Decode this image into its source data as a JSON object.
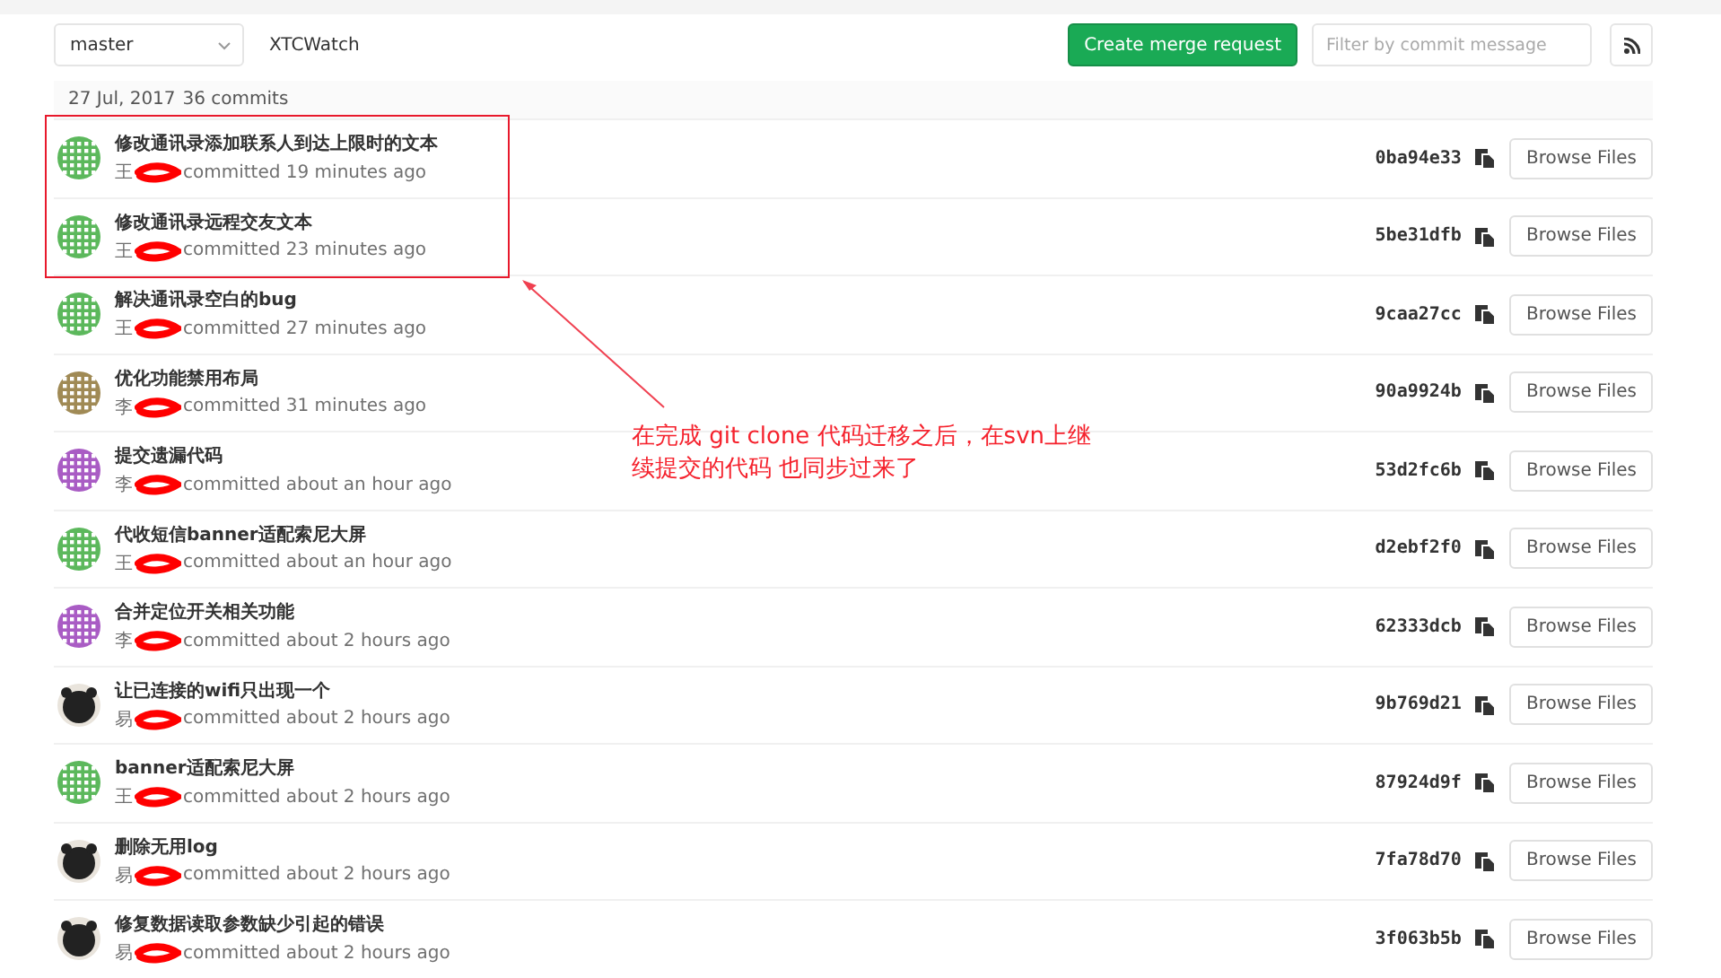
{
  "toolbar": {
    "branch": "master",
    "project": "XTCWatch",
    "merge_button": "Create merge request",
    "filter": {
      "placeholder": "Filter by commit message"
    }
  },
  "day_header": {
    "date": "27 Jul, 2017",
    "count": "36 commits"
  },
  "commits": [
    {
      "title": "修改通讯录添加联系人到达上限时的文本",
      "author": "王",
      "redacted": true,
      "time": "committed 19 minutes ago",
      "sha": "0ba94e33",
      "browse": "Browse Files",
      "avatar": {
        "kind": "identicon",
        "color": "#5cb85c"
      }
    },
    {
      "title": "修改通讯录远程交友文本",
      "author": "王",
      "redacted": true,
      "time": "committed 23 minutes ago",
      "sha": "5be31dfb",
      "browse": "Browse Files",
      "avatar": {
        "kind": "identicon",
        "color": "#5cb85c"
      }
    },
    {
      "title": "解决通讯录空白的bug",
      "author": "王",
      "redacted": true,
      "time": "committed 27 minutes ago",
      "sha": "9caa27cc",
      "browse": "Browse Files",
      "avatar": {
        "kind": "identicon",
        "color": "#5cb85c"
      }
    },
    {
      "title": "优化功能禁用布局",
      "author": "李",
      "redacted": true,
      "time": "committed 31 minutes ago",
      "sha": "90a9924b",
      "browse": "Browse Files",
      "avatar": {
        "kind": "identicon",
        "color": "#a08a55"
      }
    },
    {
      "title": "提交遗漏代码",
      "author": "李",
      "redacted": true,
      "time": "committed about an hour ago",
      "sha": "53d2fc6b",
      "browse": "Browse Files",
      "avatar": {
        "kind": "identicon",
        "color": "#a95cc4"
      }
    },
    {
      "title": "代收短信banner适配索尼大屏",
      "author": "王",
      "redacted": true,
      "time": "committed about an hour ago",
      "sha": "d2ebf2f0",
      "browse": "Browse Files",
      "avatar": {
        "kind": "identicon",
        "color": "#5cb85c"
      }
    },
    {
      "title": "合并定位开关相关功能",
      "author": "李",
      "redacted": true,
      "time": "committed about 2 hours ago",
      "sha": "62333dcb",
      "browse": "Browse Files",
      "avatar": {
        "kind": "identicon",
        "color": "#a95cc4"
      }
    },
    {
      "title": "让已连接的wifi只出现一个",
      "author": "易",
      "redacted": true,
      "time": "committed about 2 hours ago",
      "sha": "9b769d21",
      "browse": "Browse Files",
      "avatar": {
        "kind": "figure",
        "color": "#222222"
      }
    },
    {
      "title": "banner适配索尼大屏",
      "author": "王",
      "redacted": true,
      "time": "committed about 2 hours ago",
      "sha": "87924d9f",
      "browse": "Browse Files",
      "avatar": {
        "kind": "identicon",
        "color": "#5cb85c"
      }
    },
    {
      "title": "删除无用log",
      "author": "易",
      "redacted": true,
      "time": "committed about 2 hours ago",
      "sha": "7fa78d70",
      "browse": "Browse Files",
      "avatar": {
        "kind": "figure",
        "color": "#222222"
      }
    },
    {
      "title": "修复数据读取参数缺少引起的错误",
      "author": "易",
      "redacted": true,
      "time": "committed about 2 hours ago",
      "sha": "3f063b5b",
      "browse": "Browse Files",
      "avatar": {
        "kind": "figure",
        "color": "#222222"
      }
    }
  ],
  "annotation": {
    "note": "在完成 git clone 代码迁移之后，在svn上继续提交的代码 也同步过来了"
  }
}
